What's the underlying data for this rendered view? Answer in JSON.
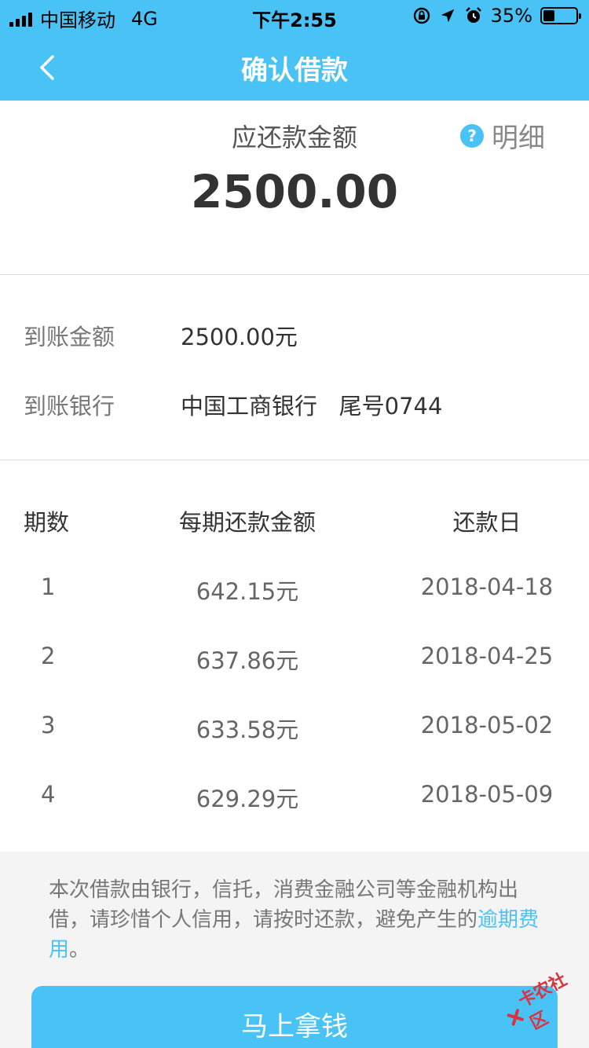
{
  "status_bar": {
    "carrier": "中国移动",
    "network": "4G",
    "time": "下午2:55",
    "battery": "35%",
    "battery_level": 0.35
  },
  "nav": {
    "title": "确认借款",
    "back_icon": "chevron-left-icon"
  },
  "summary": {
    "label": "应还款金额",
    "detail_label": "明细",
    "detail_icon": "question-circle-icon",
    "amount": "2500.00"
  },
  "info": {
    "received_amount_label": "到账金额",
    "received_amount_value": "2500.00元",
    "bank_label": "到账银行",
    "bank_value": "中国工商银行   尾号0744"
  },
  "plan": {
    "headers": [
      "期数",
      "每期还款金额",
      "还款日"
    ],
    "rows": [
      [
        "1",
        "642.15元",
        "2018-04-18"
      ],
      [
        "2",
        "637.86元",
        "2018-04-25"
      ],
      [
        "3",
        "633.58元",
        "2018-05-02"
      ],
      [
        "4",
        "629.29元",
        "2018-05-09"
      ]
    ]
  },
  "notice": {
    "text": "本次借款由银行，信托，消费金融公司等金融机构出借，请珍惜个人信用，请按时还款，避免产生的",
    "link": "逾期费用",
    "end": "。"
  },
  "cta": {
    "label": "马上拿钱"
  },
  "watermark": {
    "text": "卡农社区"
  },
  "colors": {
    "accent": "#49c3f5",
    "watermark": "#d9333f"
  }
}
